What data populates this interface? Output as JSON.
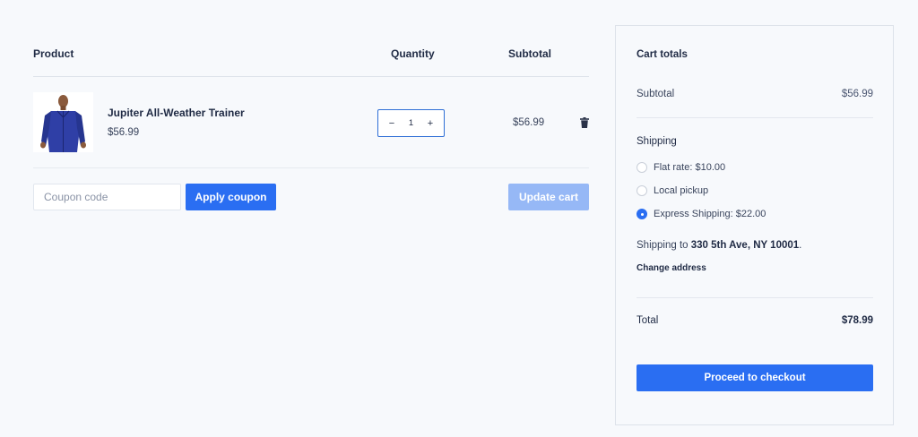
{
  "cart": {
    "headers": {
      "product": "Product",
      "quantity": "Quantity",
      "subtotal": "Subtotal"
    },
    "items": [
      {
        "name": "Jupiter All-Weather Trainer",
        "price": "$56.99",
        "quantity": "1",
        "subtotal": "$56.99",
        "image_icon": "jacket-product-image"
      }
    ],
    "stepper": {
      "minus": "−",
      "plus": "+"
    },
    "coupon": {
      "placeholder": "Coupon code",
      "value": ""
    },
    "apply_coupon_label": "Apply coupon",
    "update_cart_label": "Update cart"
  },
  "totals": {
    "title": "Cart totals",
    "subtotal_label": "Subtotal",
    "subtotal_value": "$56.99",
    "shipping_label": "Shipping",
    "shipping_options": [
      {
        "label": "Flat rate: $10.00",
        "selected": false
      },
      {
        "label": "Local pickup",
        "selected": false
      },
      {
        "label": "Express Shipping: $22.00",
        "selected": true
      }
    ],
    "shipping_to_prefix": "Shipping to",
    "shipping_to_address": "330 5th Ave, NY 10001",
    "shipping_to_suffix": ".",
    "change_address_label": "Change address",
    "total_label": "Total",
    "total_value": "$78.99",
    "checkout_label": "Proceed to checkout"
  },
  "colors": {
    "accent": "#2a6ef2",
    "accent_disabled": "#96b8f6",
    "background": "#f7f9fc",
    "text": "#1f2a44"
  }
}
